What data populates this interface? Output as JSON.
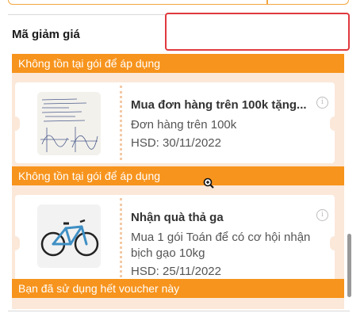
{
  "section": {
    "label": "Mã giảm giá"
  },
  "code_input": {
    "value": "",
    "placeholder": ""
  },
  "vouchers": [
    {
      "status": "Không tồn tại gói để áp dụng",
      "title": "Mua đơn hàng trên 100k tặng...",
      "desc": "Đơn hàng trên 100k",
      "expiry": "HSD: 30/11/2022",
      "thumb_icon": "handwritten-notes-image",
      "info_icon": "info-icon"
    },
    {
      "status": "Không tồn tại gói để áp dụng",
      "title": "Nhận quà thả ga",
      "desc": "Mua 1 gói Toán để có cơ hội nhận bịch gạo 10kg",
      "expiry": "HSD: 25/11/2022",
      "thumb_icon": "bicycle-image",
      "info_icon": "info-icon"
    }
  ],
  "footer_status": "Bạn đã sử dụng hết voucher này",
  "colors": {
    "accent": "#f7941d",
    "panel": "#fbe8d9",
    "highlight": "#e0393e"
  }
}
